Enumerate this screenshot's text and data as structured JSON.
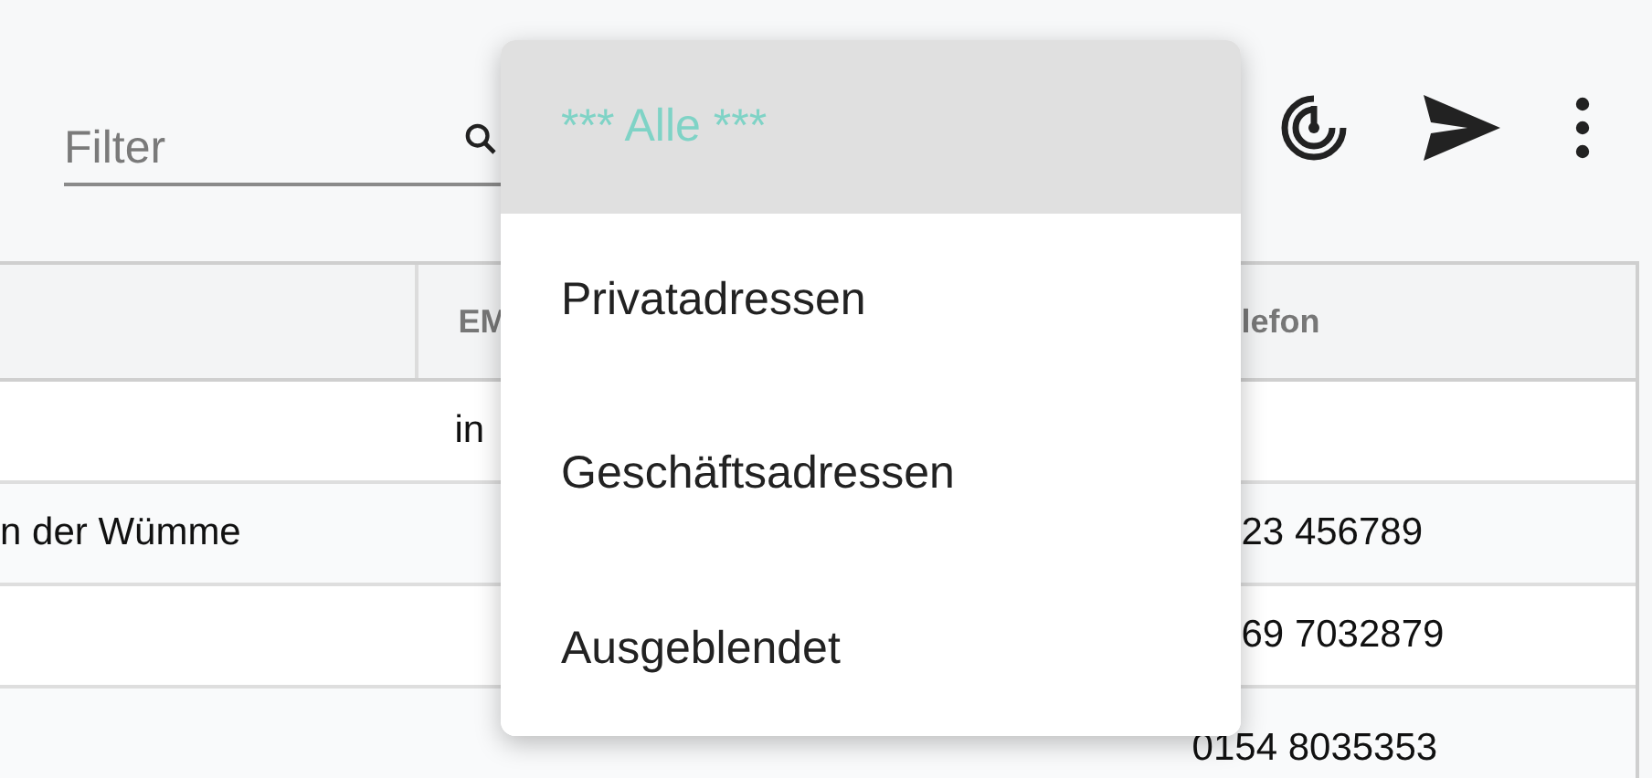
{
  "toolbar": {
    "filter": {
      "placeholder": "Filter"
    }
  },
  "table": {
    "columns": [
      "",
      "EM",
      "lefon"
    ],
    "rows": [
      [
        "",
        "in",
        ""
      ],
      [
        "n der Wümme",
        "",
        "23 456789"
      ],
      [
        "",
        "",
        "69 7032879"
      ],
      [
        "",
        "",
        "0154 8035353"
      ]
    ]
  },
  "dropdown": {
    "items": [
      {
        "label": "*** Alle ***",
        "selected": true
      },
      {
        "label": "Privatadressen",
        "selected": false
      },
      {
        "label": "Geschäftsadressen",
        "selected": false
      },
      {
        "label": "Ausgeblendet",
        "selected": false
      }
    ]
  }
}
